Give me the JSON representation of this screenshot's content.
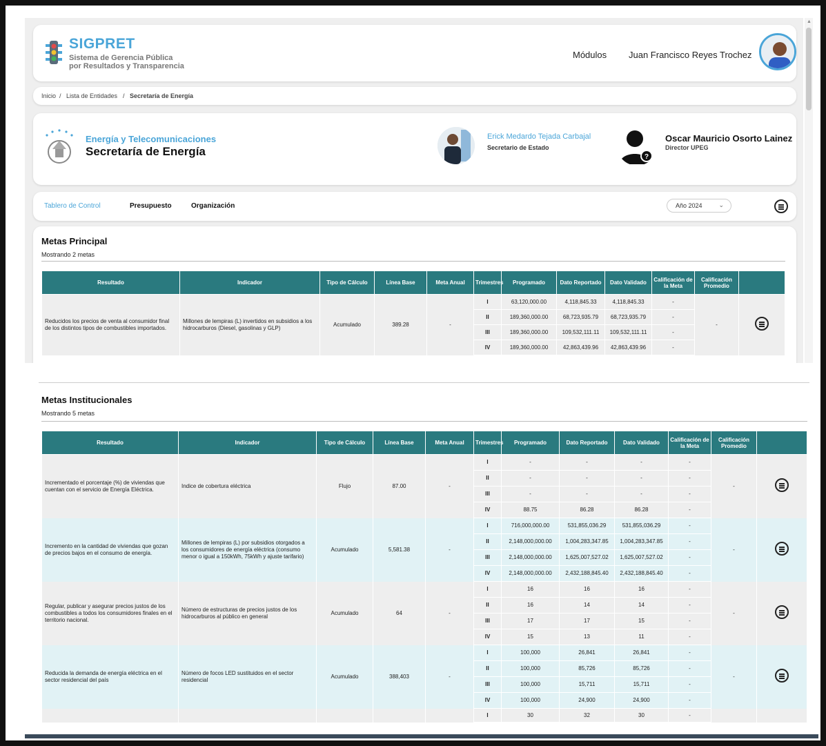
{
  "header": {
    "app_title": "SIGPRET",
    "app_subtitle_line1": "Sistema de Gerencia Pública",
    "app_subtitle_line2": "por Resultados y Transparencia",
    "modulos_label": "Módulos",
    "user_name": "Juan Francisco Reyes Trochez"
  },
  "breadcrumb": {
    "items": [
      "Inicio",
      "Lista de Entidades",
      "Secretaría de Energía"
    ],
    "separator": "/"
  },
  "entity": {
    "sector": "Energía y Telecomunicaciones",
    "name": "Secretaría de Energía",
    "official_a_name": "Erick Medardo Tejada Carbajal",
    "official_a_role": "Secretario de Estado",
    "official_b_name": "Oscar Mauricio Osorto Lainez",
    "official_b_role": "Director UPEG"
  },
  "tabs": {
    "items": [
      "Tablero de Control",
      "Presupuesto",
      "Organización"
    ],
    "active": "Tablero de Control",
    "year_selected": "Año 2024"
  },
  "colors": {
    "accent": "#4aa5d8",
    "table_header": "#2a7a7f",
    "row_alt": "#e1f2f5",
    "row": "#eeeeee"
  },
  "columns": [
    "Resultado",
    "Indicador",
    "Tipo de Cálculo",
    "Línea Base",
    "Meta Anual",
    "Trimestres",
    "Programado",
    "Dato Reportado",
    "Dato Validado",
    "Calificación de la Meta",
    "Calificación Promedio"
  ],
  "metas_principal": {
    "title": "Metas Principal",
    "count_label": "Mostrando 2 metas",
    "rows": [
      {
        "resultado": "Reducidos los precios de venta al consumidor final de los distintos tipos de combustibles importados.",
        "indicador": "Millones de lempiras (L) invertidos en subsidios a los hidrocarburos (Diesel, gasolinas y GLP)",
        "tipo": "Acumulado",
        "linea_base": "389.28",
        "meta_anual": "-",
        "promedio": "-",
        "quarters": [
          {
            "q": "I",
            "programado": "63,120,000.00",
            "reportado": "4,118,845.33",
            "validado": "4,118,845.33",
            "calificacion": "-"
          },
          {
            "q": "II",
            "programado": "189,360,000.00",
            "reportado": "68,723,935.79",
            "validado": "68,723,935.79",
            "calificacion": "-"
          },
          {
            "q": "III",
            "programado": "189,360,000.00",
            "reportado": "109,532,111.11",
            "validado": "109,532,111.11",
            "calificacion": "-"
          },
          {
            "q": "IV",
            "programado": "189,360,000.00",
            "reportado": "42,863,439.96",
            "validado": "42,863,439.96",
            "calificacion": "-"
          }
        ]
      }
    ]
  },
  "metas_institucionales": {
    "title": "Metas Institucionales",
    "count_label": "Mostrando 5 metas",
    "rows": [
      {
        "resultado": "Incrementado el porcentaje (%) de viviendas que cuentan con el servicio de Energía Eléctrica.",
        "indicador": "Indice de cobertura eléctrica",
        "tipo": "Flujo",
        "linea_base": "87.00",
        "meta_anual": "-",
        "promedio": "-",
        "quarters": [
          {
            "q": "I",
            "programado": "-",
            "reportado": "-",
            "validado": "-",
            "calificacion": "-"
          },
          {
            "q": "II",
            "programado": "-",
            "reportado": "-",
            "validado": "-",
            "calificacion": "-"
          },
          {
            "q": "III",
            "programado": "-",
            "reportado": "-",
            "validado": "-",
            "calificacion": "-"
          },
          {
            "q": "IV",
            "programado": "88.75",
            "reportado": "86.28",
            "validado": "86.28",
            "calificacion": "-"
          }
        ]
      },
      {
        "resultado": "Incremento en la cantidad de viviendas que gozan de precios bajos en el consumo de energía.",
        "indicador": "Millones de lempiras (L) por subsidios otorgados a los consumidores de energía eléctrica (consumo menor o igual a 150kWh, 75kWh y ajuste tarifario)",
        "tipo": "Acumulado",
        "linea_base": "5,581.38",
        "meta_anual": "-",
        "promedio": "-",
        "quarters": [
          {
            "q": "I",
            "programado": "716,000,000.00",
            "reportado": "531,855,036.29",
            "validado": "531,855,036.29",
            "calificacion": "-"
          },
          {
            "q": "II",
            "programado": "2,148,000,000.00",
            "reportado": "1,004,283,347.85",
            "validado": "1,004,283,347.85",
            "calificacion": "-"
          },
          {
            "q": "III",
            "programado": "2,148,000,000.00",
            "reportado": "1,625,007,527.02",
            "validado": "1,625,007,527.02",
            "calificacion": "-"
          },
          {
            "q": "IV",
            "programado": "2,148,000,000.00",
            "reportado": "2,432,188,845.40",
            "validado": "2,432,188,845.40",
            "calificacion": "-"
          }
        ]
      },
      {
        "resultado": "Regular, publicar y asegurar precios justos de los combustibles a todos los consumidores finales en el territorio nacional.",
        "indicador": "Número de estructuras de precios justos de los hidrocarburos al público en general",
        "tipo": "Acumulado",
        "linea_base": "64",
        "meta_anual": "-",
        "promedio": "-",
        "quarters": [
          {
            "q": "I",
            "programado": "16",
            "reportado": "16",
            "validado": "16",
            "calificacion": "-"
          },
          {
            "q": "II",
            "programado": "16",
            "reportado": "14",
            "validado": "14",
            "calificacion": "-"
          },
          {
            "q": "III",
            "programado": "17",
            "reportado": "17",
            "validado": "15",
            "calificacion": "-"
          },
          {
            "q": "IV",
            "programado": "15",
            "reportado": "13",
            "validado": "11",
            "calificacion": "-"
          }
        ]
      },
      {
        "resultado": "Reducida la demanda de energía eléctrica en el sector residencial del país",
        "indicador": "Número de focos LED sustituidos en el sector residencial",
        "tipo": "Acumulado",
        "linea_base": "388,403",
        "meta_anual": "-",
        "promedio": "-",
        "quarters": [
          {
            "q": "I",
            "programado": "100,000",
            "reportado": "26,841",
            "validado": "26,841",
            "calificacion": "-"
          },
          {
            "q": "II",
            "programado": "100,000",
            "reportado": "85,726",
            "validado": "85,726",
            "calificacion": "-"
          },
          {
            "q": "III",
            "programado": "100,000",
            "reportado": "15,711",
            "validado": "15,711",
            "calificacion": "-"
          },
          {
            "q": "IV",
            "programado": "100,000",
            "reportado": "24,900",
            "validado": "24,900",
            "calificacion": "-"
          }
        ]
      },
      {
        "resultado": "",
        "indicador": "",
        "tipo": "",
        "linea_base": "",
        "meta_anual": "",
        "promedio": "",
        "quarters": [
          {
            "q": "I",
            "programado": "30",
            "reportado": "32",
            "validado": "30",
            "calificacion": "-"
          }
        ]
      }
    ]
  }
}
